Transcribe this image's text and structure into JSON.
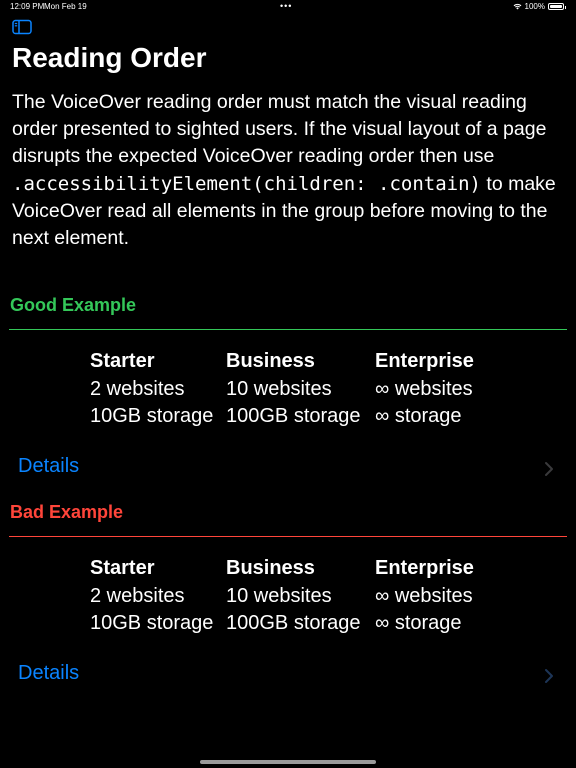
{
  "status_bar": {
    "time": "12:09 PM",
    "date": "Mon Feb 19",
    "dots": "•••",
    "battery": "100%"
  },
  "sidebar_toggle_icon": "sidebar-left-icon",
  "page": {
    "title": "Reading Order",
    "description_before": "The VoiceOver reading order must match the visual reading order presented to sighted users. If the visual layout of a page disrupts the expected VoiceOver reading order then use ",
    "code": ".accessibilityElement(children: .contain)",
    "description_after": " to make VoiceOver read all elements in the group before moving to the next element."
  },
  "good_example": {
    "label": "Good Example",
    "color": "#34c759",
    "plans": [
      {
        "name": "Starter",
        "websites": "2 websites",
        "storage": "10GB storage"
      },
      {
        "name": "Business",
        "websites": "10 websites",
        "storage": "100GB storage"
      },
      {
        "name": "Enterprise",
        "websites": "∞ websites",
        "storage": "∞ storage"
      }
    ],
    "details_label": "Details"
  },
  "bad_example": {
    "label": "Bad Example",
    "color": "#ff453a",
    "plans": [
      {
        "name": "Starter",
        "websites": "2 websites",
        "storage": "10GB storage"
      },
      {
        "name": "Business",
        "websites": "10 websites",
        "storage": "100GB storage"
      },
      {
        "name": "Enterprise",
        "websites": "∞ websites",
        "storage": "∞ storage"
      }
    ],
    "details_label": "Details"
  },
  "colors": {
    "accent": "#0a84ff",
    "background": "#000000",
    "chevron": "#3a3a3c"
  }
}
